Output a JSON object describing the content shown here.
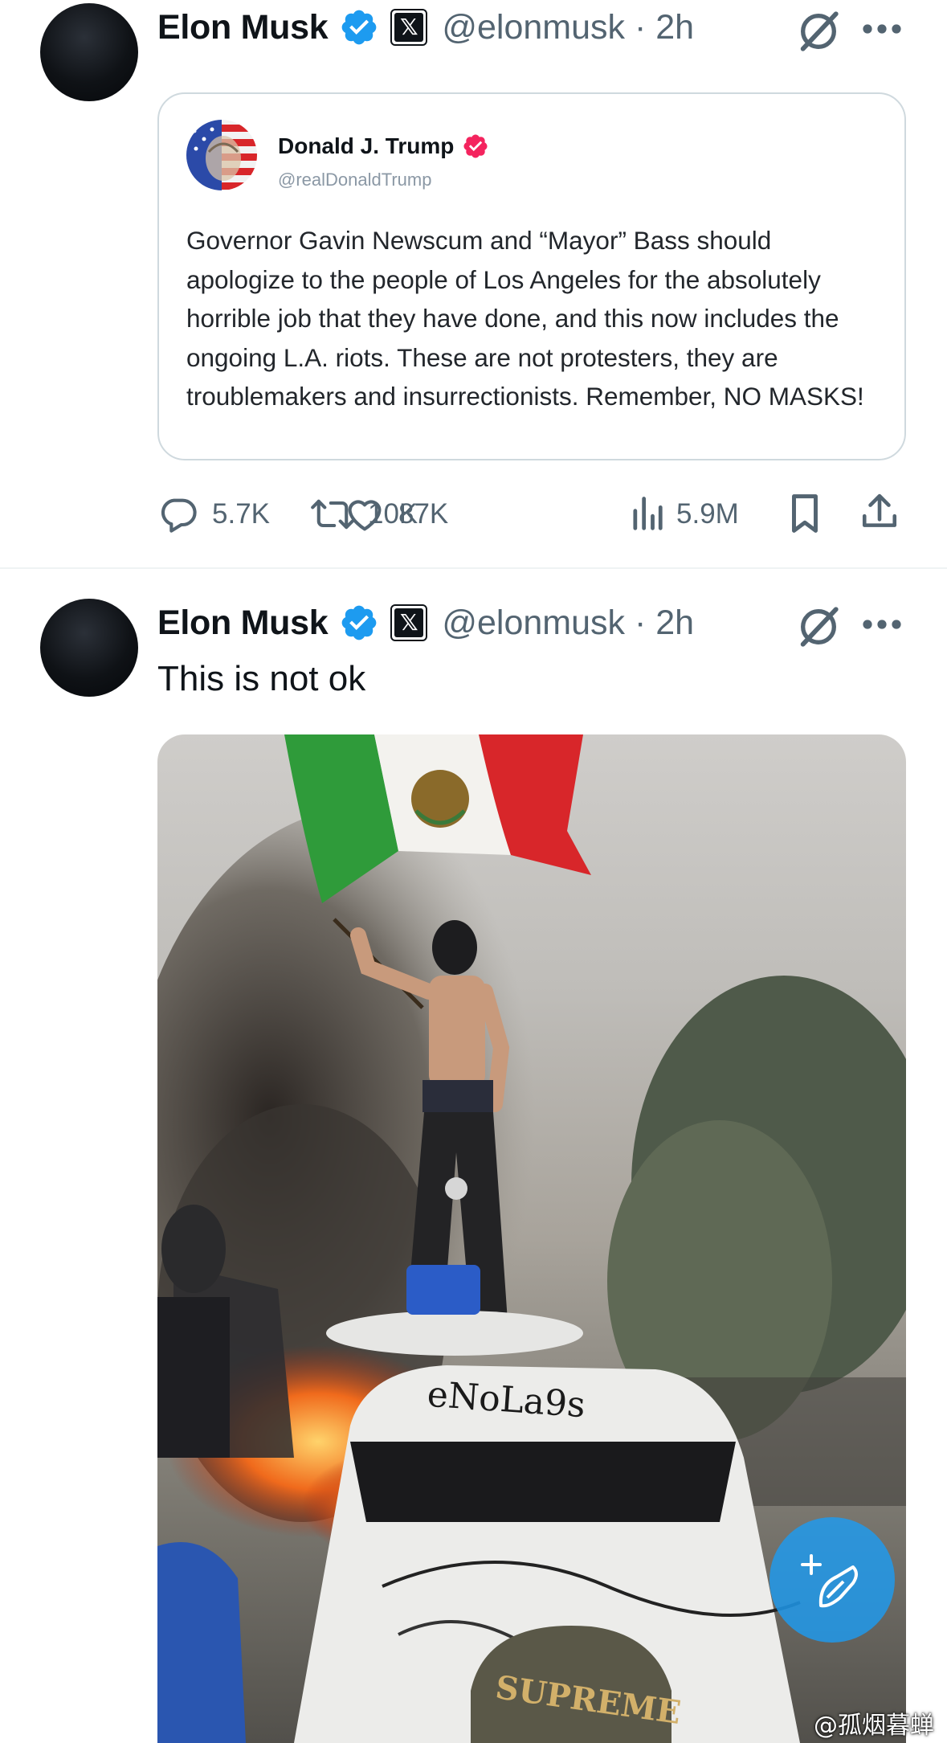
{
  "tweet1": {
    "author": "Elon Musk",
    "handle": "@elonmusk · 2h",
    "quote": {
      "author": "Donald J. Trump",
      "handle": "@realDonaldTrump",
      "text": "Governor Gavin Newscum and “Mayor” Bass should apologize to the people of Los Angeles for the absolutely horrible job that they have done, and this now includes the ongoing L.A. riots. These are not protesters, they are troublemakers and insurrectionists. Remember, NO MASKS!"
    },
    "actions": {
      "replies": "5.7K",
      "reposts": "10K",
      "likes": "87K",
      "views": "5.9M"
    }
  },
  "tweet2": {
    "author": "Elon Musk",
    "handle": "@elonmusk · 2h",
    "text": "This is not ok",
    "media": {
      "car_graffiti": "eNoLa9s",
      "cap_text": "SUPREME"
    }
  },
  "watermark": "@孤烟暮蝉",
  "colors": {
    "verified_blue": "#1d9bf0",
    "verified_pink": "#f4245e",
    "secondary_text": "#536471",
    "border": "#cfd9de",
    "flag_green": "#2f9b3a",
    "flag_red": "#d8262a"
  },
  "icons": [
    "verified-badge-icon",
    "x-affiliate-icon",
    "grok-icon",
    "more-icon",
    "reply-icon",
    "repost-icon",
    "like-icon",
    "views-icon",
    "bookmark-icon",
    "share-icon"
  ]
}
